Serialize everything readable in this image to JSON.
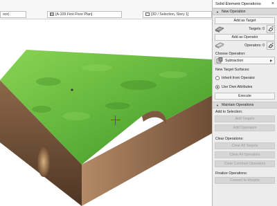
{
  "tabs": [
    {
      "label": "oor)",
      "icon": "view-icon"
    },
    {
      "label": "[A-109 First Floor Plan]",
      "icon": "floor-plan-icon"
    },
    {
      "label": "[3D / Selection, Story 1]",
      "icon": "3d-view-icon"
    }
  ],
  "panel": {
    "title": "Solid Element Operations",
    "close_glyph": "×",
    "new_operation": {
      "header": "New Operation",
      "add_target": "Add as Target",
      "targets": "Targets: 0",
      "add_operator": "Add as Operator",
      "operators": "Operators: 0",
      "choose_label": "Choose Operation:",
      "operation": "Subtraction",
      "surfaces_label": "New Target Surfaces:",
      "radio_inherit": "Inherit from Operator",
      "radio_own": "Use Own Attributes",
      "radio_selected": "own",
      "execute": "Execute"
    },
    "maintain": {
      "header": "Maintain Operations",
      "add_to_selection": "Add to Selection:",
      "add_targets": "Add Targets",
      "add_operators": "Add Operators",
      "clear_label": "Clear Operations:",
      "clear_targets": "Clear All Targets",
      "clear_operators": "Clear All Operators",
      "clear_common": "Clear Common Operators",
      "finalize_label": "Finalize Operations:",
      "convert": "Convert to Morphs"
    }
  },
  "colors": {
    "grass_light": "#7fcb4a",
    "grass_dark": "#3f8f22",
    "soil_light": "#a07a5a",
    "soil_dark": "#5a3e2a"
  }
}
